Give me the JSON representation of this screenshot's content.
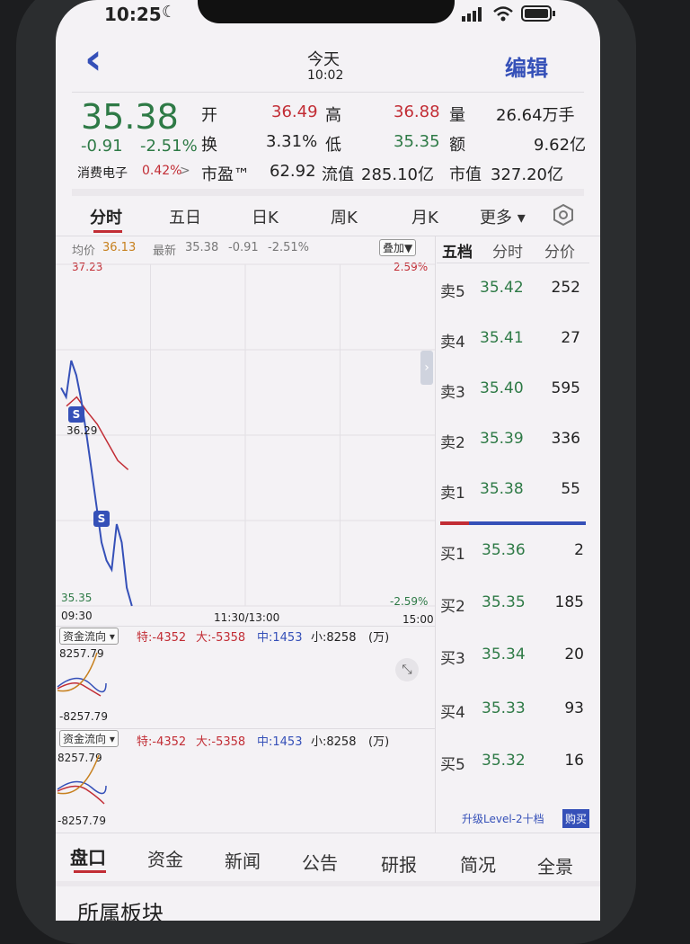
{
  "status_bar": {
    "time": "10:25",
    "moon": "☾"
  },
  "nav": {
    "back": "‹",
    "title": "今天",
    "subtitle": "10:02",
    "edit": "编辑"
  },
  "quote": {
    "price": "35.38",
    "change": "-0.91",
    "pct": "-2.51%",
    "sector": "消费电子",
    "sector_pct": "0.42%",
    "sector_arrow": ">",
    "open_label": "开",
    "open": "36.49",
    "high_label": "高",
    "high": "36.88",
    "vol_label": "量",
    "vol": "26.64万手",
    "turn_label": "换",
    "turn": "3.31%",
    "low_label": "低",
    "low": "35.35",
    "amt_label": "额",
    "amt": "9.62亿",
    "pe_label": "市盈™",
    "pe": "62.92",
    "float_label": "流值",
    "float": "285.10亿",
    "cap_label": "市值",
    "cap": "327.20亿"
  },
  "period_tabs": [
    "分时",
    "五日",
    "日K",
    "周K",
    "月K",
    "更多 ▾"
  ],
  "chart_header": {
    "avg_label": "均价",
    "avg": "36.13",
    "latest_label": "最新",
    "latest": "35.38",
    "chg": "-0.91",
    "pct": "-2.51%",
    "overlay": "叠加▼"
  },
  "chart_labels": {
    "top_price": "37.23",
    "top_pct": "2.59%",
    "mid_price": "36.29",
    "bottom_price": "35.35",
    "bottom_pct": "-2.59%",
    "t_start": "09:30",
    "t_mid": "11:30/13:00",
    "t_end": "15:00",
    "marker": "S"
  },
  "chart_data": {
    "type": "line",
    "series": [
      {
        "values": [
          36.55,
          36.5,
          36.7,
          36.62,
          36.48,
          36.3,
          36.1,
          35.9,
          35.7,
          35.6,
          35.55,
          35.8,
          35.7,
          35.45,
          35.35
        ]
      },
      {
        "values": [
          36.45,
          36.5,
          36.42,
          36.35,
          36.25,
          36.15,
          36.1
        ]
      }
    ],
    "ylim": [
      35.35,
      37.23
    ]
  },
  "flow": {
    "label": "资金流向 ▾",
    "te": "特:-4352",
    "da": "大:-5358",
    "zhong": "中:1453",
    "xiao": "小:8258",
    "unit": "(万)",
    "top": "8257.79",
    "bottom": "-8257.79"
  },
  "ob_tabs": [
    "五档",
    "分时",
    "分价"
  ],
  "asks": [
    {
      "label": "卖5",
      "price": "35.42",
      "vol": "252"
    },
    {
      "label": "卖4",
      "price": "35.41",
      "vol": "27"
    },
    {
      "label": "卖3",
      "price": "35.40",
      "vol": "595"
    },
    {
      "label": "卖2",
      "price": "35.39",
      "vol": "336"
    },
    {
      "label": "卖1",
      "price": "35.38",
      "vol": "55"
    }
  ],
  "bids": [
    {
      "label": "买1",
      "price": "35.36",
      "vol": "2"
    },
    {
      "label": "买2",
      "price": "35.35",
      "vol": "185"
    },
    {
      "label": "买3",
      "price": "35.34",
      "vol": "20"
    },
    {
      "label": "买4",
      "price": "35.33",
      "vol": "93"
    },
    {
      "label": "买5",
      "price": "35.32",
      "vol": "16"
    }
  ],
  "upgrade": {
    "text": "升级Level-2十档",
    "buy": "购买"
  },
  "bottom_tabs": [
    "盘口",
    "资金",
    "新闻",
    "公告",
    "研报",
    "简况",
    "全景"
  ],
  "section_title": "所属板块"
}
